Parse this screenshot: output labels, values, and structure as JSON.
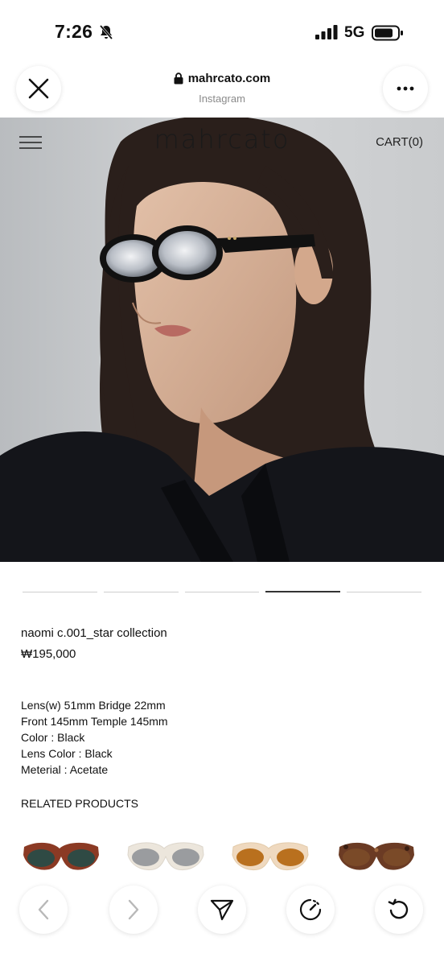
{
  "status_bar": {
    "time": "7:26",
    "network": "5G",
    "icons": [
      "bell-muted-icon",
      "signal-bars-icon",
      "battery-icon"
    ]
  },
  "browser": {
    "url": "mahrcato.com",
    "source": "Instagram",
    "icons": [
      "close-icon",
      "lock-icon",
      "more-icon"
    ]
  },
  "site": {
    "logo": "mahrcato",
    "cart_label": "CART(0)",
    "menu_icon": "hamburger-menu-icon"
  },
  "carousel": {
    "total": 5,
    "active_index": 3
  },
  "product": {
    "name": "naomi c.001_star collection",
    "price": "₩195,000",
    "specs": [
      "Lens(w) 51mm Bridge 22mm",
      "Front 145mm Temple 145mm",
      "Color : Black",
      "Lens Color : Black",
      "Meterial : Acetate"
    ]
  },
  "related": {
    "title": "RELATED PRODUCTS",
    "items": [
      {
        "name": "red-brown-sunglasses",
        "frame_color": "#8b3a24",
        "lens_color": "#2f4a44"
      },
      {
        "name": "ivory-grey-sunglasses",
        "frame_color": "#ece6dc",
        "lens_color": "#9a9c9f"
      },
      {
        "name": "ivory-amber-sunglasses",
        "frame_color": "#efd9bf",
        "lens_color": "#b9701e"
      },
      {
        "name": "tortoise-sunglasses",
        "frame_color": "#6b3b24",
        "lens_color": "#7a4a28"
      }
    ]
  },
  "toolbar": {
    "icons": [
      "back-icon",
      "forward-icon",
      "share-icon",
      "speed-icon",
      "reload-icon"
    ]
  },
  "colors": {
    "background": "#ffffff",
    "text": "#111111",
    "indicator_active": "#333333",
    "indicator_inactive": "#cfcfcf",
    "muted_text": "#8a8a8a"
  }
}
